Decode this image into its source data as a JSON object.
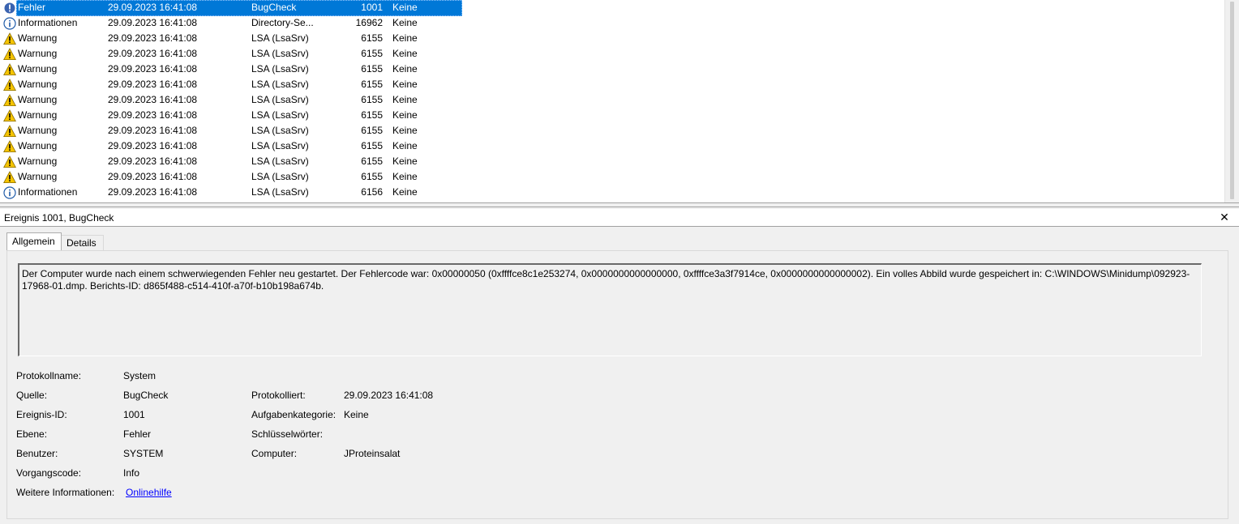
{
  "event_list": {
    "rows": [
      {
        "level": "Fehler",
        "date": "29.09.2023 16:41:08",
        "source": "BugCheck",
        "id": "1001",
        "category": "Keine",
        "icon": "error-icon",
        "selected": true
      },
      {
        "level": "Informationen",
        "date": "29.09.2023 16:41:08",
        "source": "Directory-Se...",
        "id": "16962",
        "category": "Keine",
        "icon": "info-icon"
      },
      {
        "level": "Warnung",
        "date": "29.09.2023 16:41:08",
        "source": "LSA (LsaSrv)",
        "id": "6155",
        "category": "Keine",
        "icon": "warning-icon"
      },
      {
        "level": "Warnung",
        "date": "29.09.2023 16:41:08",
        "source": "LSA (LsaSrv)",
        "id": "6155",
        "category": "Keine",
        "icon": "warning-icon"
      },
      {
        "level": "Warnung",
        "date": "29.09.2023 16:41:08",
        "source": "LSA (LsaSrv)",
        "id": "6155",
        "category": "Keine",
        "icon": "warning-icon"
      },
      {
        "level": "Warnung",
        "date": "29.09.2023 16:41:08",
        "source": "LSA (LsaSrv)",
        "id": "6155",
        "category": "Keine",
        "icon": "warning-icon"
      },
      {
        "level": "Warnung",
        "date": "29.09.2023 16:41:08",
        "source": "LSA (LsaSrv)",
        "id": "6155",
        "category": "Keine",
        "icon": "warning-icon"
      },
      {
        "level": "Warnung",
        "date": "29.09.2023 16:41:08",
        "source": "LSA (LsaSrv)",
        "id": "6155",
        "category": "Keine",
        "icon": "warning-icon"
      },
      {
        "level": "Warnung",
        "date": "29.09.2023 16:41:08",
        "source": "LSA (LsaSrv)",
        "id": "6155",
        "category": "Keine",
        "icon": "warning-icon"
      },
      {
        "level": "Warnung",
        "date": "29.09.2023 16:41:08",
        "source": "LSA (LsaSrv)",
        "id": "6155",
        "category": "Keine",
        "icon": "warning-icon"
      },
      {
        "level": "Warnung",
        "date": "29.09.2023 16:41:08",
        "source": "LSA (LsaSrv)",
        "id": "6155",
        "category": "Keine",
        "icon": "warning-icon"
      },
      {
        "level": "Warnung",
        "date": "29.09.2023 16:41:08",
        "source": "LSA (LsaSrv)",
        "id": "6155",
        "category": "Keine",
        "icon": "warning-icon"
      },
      {
        "level": "Informationen",
        "date": "29.09.2023 16:41:08",
        "source": "LSA (LsaSrv)",
        "id": "6156",
        "category": "Keine",
        "icon": "info-icon"
      }
    ]
  },
  "details": {
    "title": "Ereignis 1001, BugCheck",
    "close_glyph": "✕",
    "tabs": {
      "general": "Allgemein",
      "details": "Details"
    },
    "description": "Der Computer wurde nach einem schwerwiegenden Fehler neu gestartet. Der Fehlercode war: 0x00000050 (0xffffce8c1e253274, 0x0000000000000000, 0xffffce3a3f7914ce, 0x0000000000000002). Ein volles Abbild wurde gespeichert in: C:\\WINDOWS\\Minidump\\092923-17968-01.dmp. Berichts-ID: d865f488-c514-410f-a70f-b10b198a674b.",
    "fields": {
      "log_name_label": "Protokollname:",
      "log_name": "System",
      "source_label": "Quelle:",
      "source": "BugCheck",
      "logged_label": "Protokolliert:",
      "logged": "29.09.2023 16:41:08",
      "event_id_label": "Ereignis-ID:",
      "event_id": "1001",
      "task_category_label": "Aufgabenkategorie:",
      "task_category": "Keine",
      "level_label": "Ebene:",
      "level": "Fehler",
      "keywords_label": "Schlüsselwörter:",
      "keywords": "",
      "user_label": "Benutzer:",
      "user": "SYSTEM",
      "computer_label": "Computer:",
      "computer": "JProteinsalat",
      "opcode_label": "Vorgangscode:",
      "opcode": "Info",
      "more_info_label": "Weitere Informationen:",
      "more_info_link": "Onlinehilfe"
    }
  },
  "colors": {
    "selection": "#0078d7",
    "warning": "#f5c400",
    "info": "#1e5aa8",
    "error": "#3a63b0",
    "link": "#0000ff"
  }
}
